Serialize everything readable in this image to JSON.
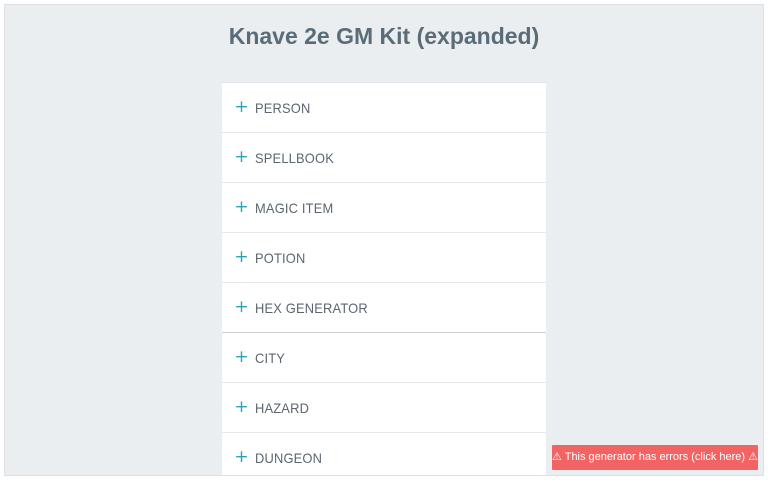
{
  "page": {
    "title": "Knave 2e GM Kit (expanded)"
  },
  "accordion": {
    "expand_icon": "plus-icon",
    "items": [
      {
        "label": "PERSON"
      },
      {
        "label": "SPELLBOOK"
      },
      {
        "label": "MAGIC ITEM"
      },
      {
        "label": "POTION"
      },
      {
        "label": "HEX GENERATOR"
      },
      {
        "label": "CITY"
      },
      {
        "label": "HAZARD"
      },
      {
        "label": "DUNGEON"
      }
    ]
  },
  "error_banner": {
    "text": "⚠ This generator has errors (click here) ⚠"
  },
  "colors": {
    "background": "#ebeef1",
    "title": "#5a6c78",
    "accent_icon": "#2aa3b6",
    "error": "#f26464"
  }
}
